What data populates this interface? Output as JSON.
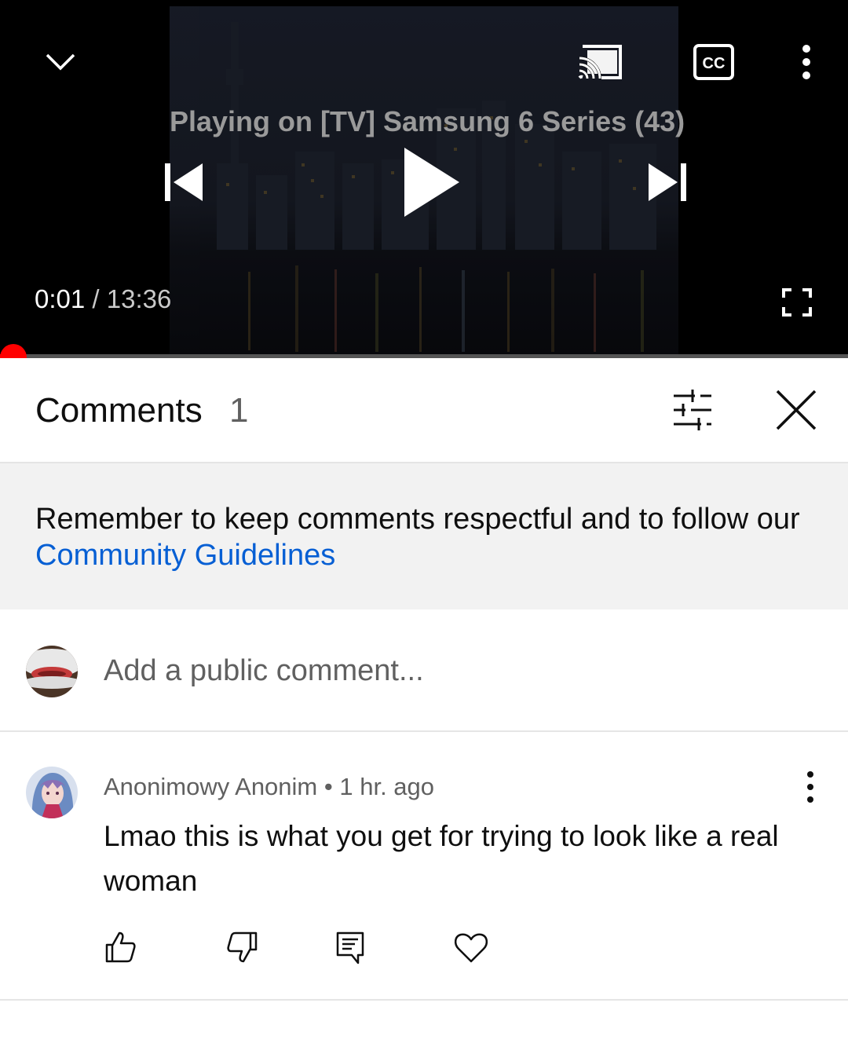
{
  "player": {
    "status": "Playing on [TV] Samsung 6 Series (43)",
    "current_time": "0:01",
    "separator": "/",
    "duration": "13:36",
    "progress_fraction": 0.001,
    "icons": {
      "collapse": "chevron-down-icon",
      "cast": "cast-icon",
      "captions": "closed-captions-icon",
      "more": "more-vert-icon",
      "previous": "skip-previous-icon",
      "play": "play-icon",
      "next": "skip-next-icon",
      "fullscreen": "fullscreen-icon"
    },
    "accent": "#ff0000"
  },
  "comments_panel": {
    "title": "Comments",
    "count": "1",
    "notice_text": "Remember to keep comments respectful and to follow our ",
    "notice_link": "Community Guidelines",
    "link_color": "#065fd4",
    "add_comment_placeholder": "Add a public comment..."
  },
  "comments": [
    {
      "author": "Anonimowy Anonim",
      "dot": "•",
      "time": "1 hr. ago",
      "text": "Lmao this is what you get for trying to look like a real woman",
      "actions": [
        "like-icon",
        "dislike-icon",
        "reply-icon",
        "heart-icon"
      ]
    }
  ]
}
